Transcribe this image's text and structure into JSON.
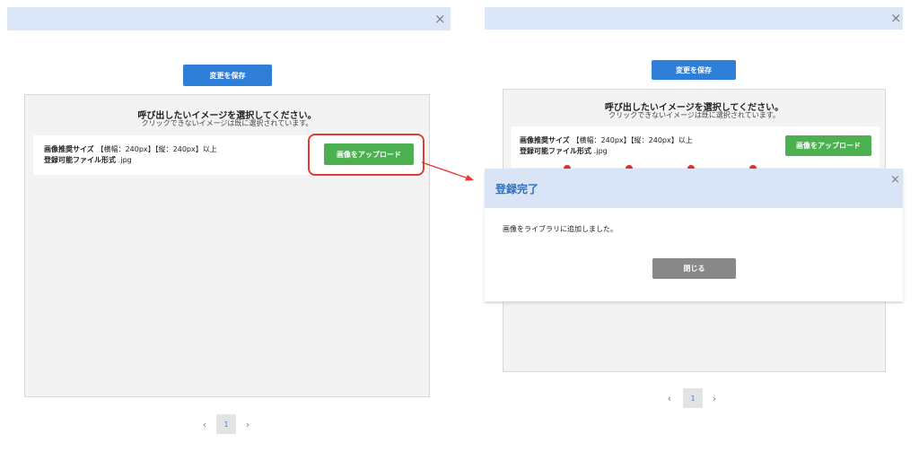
{
  "left": {
    "close_icon": "×",
    "save_button": "変更を保存",
    "library_title": "呼び出したいイメージを選択してください。",
    "library_subtitle": "クリックできないイメージは既に選択されています。",
    "size_label": "画像推奨サイズ",
    "size_value": "【横幅：240px】【縦：240px】以上",
    "format_label": "登録可能ファイル形式",
    "format_value": ".jpg",
    "upload_button": "画像をアップロード",
    "pager": {
      "prev": "‹",
      "page": "1",
      "next": "›"
    }
  },
  "right": {
    "close_icon": "×",
    "save_button": "変更を保存",
    "library_title": "呼び出したいイメージを選択してください。",
    "library_subtitle": "クリックできないイメージは既に選択されています。",
    "size_label": "画像推奨サイズ",
    "size_value": "【横幅：240px】【縦：240px】以上",
    "format_label": "登録可能ファイル形式",
    "format_value": ".jpg",
    "upload_button": "画像をアップロード",
    "pager": {
      "prev": "‹",
      "page": "1",
      "next": "›"
    }
  },
  "modal": {
    "title": "登録完了",
    "close_icon": "×",
    "message": "画像をライブラリに追加しました。",
    "close_button": "閉じる"
  },
  "colors": {
    "accent_blue": "#2f7fd8",
    "upload_green": "#4caf50",
    "highlight_red": "#e53935",
    "header_bg": "#dbe6f8"
  }
}
